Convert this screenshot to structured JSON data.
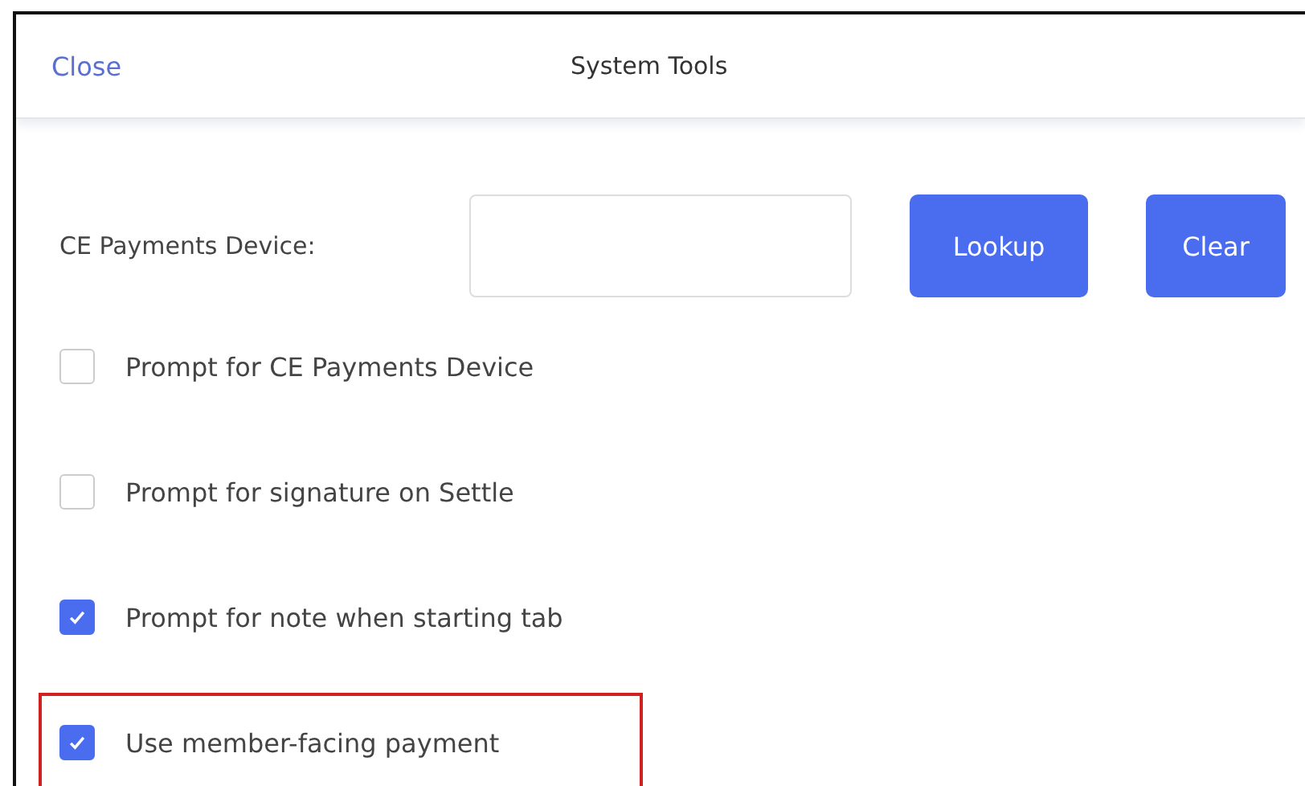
{
  "header": {
    "close": "Close",
    "title": "System Tools"
  },
  "device": {
    "label": "CE Payments Device:",
    "buttons": [
      "Lookup",
      "Clear"
    ]
  },
  "options": [
    {
      "label": "Prompt for CE Payments Device",
      "checked": false,
      "highlighted": false
    },
    {
      "label": "Prompt for signature on Settle",
      "checked": false,
      "highlighted": false
    },
    {
      "label": "Prompt for note when starting tab",
      "checked": true,
      "highlighted": false
    },
    {
      "label": "Use member-facing payment",
      "checked": true,
      "highlighted": true
    }
  ]
}
